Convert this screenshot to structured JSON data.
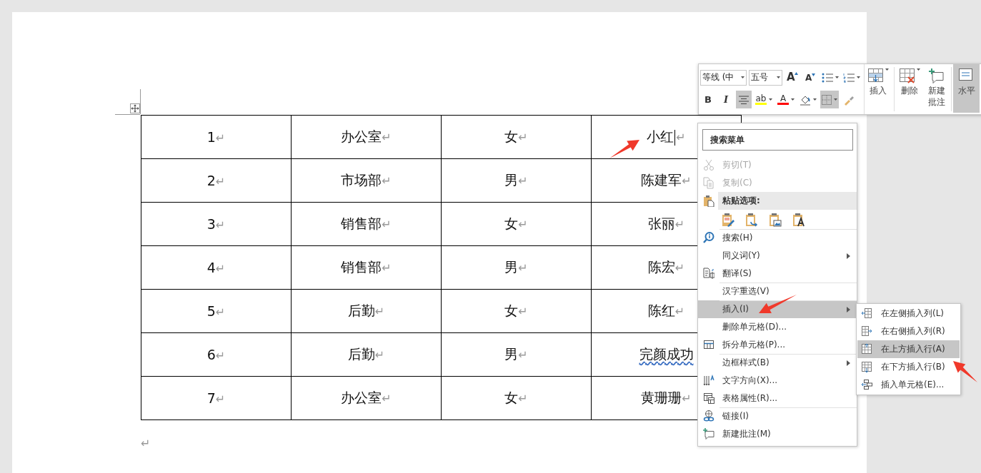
{
  "table": {
    "rows": [
      [
        {
          "text": "1",
          "end_mark": "↵"
        },
        {
          "text": "办公室",
          "end_mark": "↵"
        },
        {
          "text": "女",
          "end_mark": "↵"
        },
        {
          "text": "小红",
          "end_mark": "↵",
          "cursor": true
        }
      ],
      [
        {
          "text": "2",
          "end_mark": "↵"
        },
        {
          "text": "市场部",
          "end_mark": "↵"
        },
        {
          "text": "男",
          "end_mark": "↵"
        },
        {
          "text": "陈建军",
          "end_mark": "↵"
        }
      ],
      [
        {
          "text": "3",
          "end_mark": "↵"
        },
        {
          "text": "销售部",
          "end_mark": "↵"
        },
        {
          "text": "女",
          "end_mark": "↵"
        },
        {
          "text": "张丽",
          "end_mark": "↵"
        }
      ],
      [
        {
          "text": "4",
          "end_mark": "↵"
        },
        {
          "text": "销售部",
          "end_mark": "↵"
        },
        {
          "text": "男",
          "end_mark": "↵"
        },
        {
          "text": "陈宏",
          "end_mark": "↵"
        }
      ],
      [
        {
          "text": "5",
          "end_mark": "↵"
        },
        {
          "text": "后勤",
          "end_mark": "↵"
        },
        {
          "text": "女",
          "end_mark": "↵"
        },
        {
          "text": "陈红",
          "end_mark": "↵"
        }
      ],
      [
        {
          "text": "6",
          "end_mark": "↵"
        },
        {
          "text": "后勤",
          "end_mark": "↵"
        },
        {
          "text": "男",
          "end_mark": "↵"
        },
        {
          "text": "完颜成功",
          "spelling_error": true
        }
      ],
      [
        {
          "text": "7",
          "end_mark": "↵"
        },
        {
          "text": "办公室",
          "end_mark": "↵"
        },
        {
          "text": "女",
          "end_mark": "↵"
        },
        {
          "text": "黄珊珊",
          "end_mark": "↵"
        }
      ]
    ],
    "after_mark": "↵"
  },
  "toolbar": {
    "font_name": "等线 (中",
    "font_size": "五号",
    "row1_buttons": [
      {
        "kind": "grow",
        "glyph": "A"
      },
      {
        "kind": "shrink",
        "glyph": "A"
      },
      {
        "kind": "bullets"
      },
      {
        "kind": "numbering"
      }
    ],
    "row2_buttons": [
      {
        "kind": "bold",
        "glyph": "B",
        "selected": false
      },
      {
        "kind": "italic",
        "glyph": "I",
        "selected": false
      },
      {
        "kind": "align-center",
        "selected": true
      },
      {
        "kind": "highlight",
        "glyph": "ab",
        "color": "#ffff00",
        "selected": false
      },
      {
        "kind": "font-color",
        "glyph": "A",
        "color": "#ff0000",
        "selected": false
      },
      {
        "kind": "shading",
        "selected": false
      },
      {
        "kind": "borders",
        "selected": true
      },
      {
        "kind": "format-painter",
        "selected": false
      }
    ],
    "big_buttons": [
      {
        "kind": "insert-table",
        "label": "插入",
        "selected": false
      },
      {
        "kind": "delete-table",
        "label": "删除",
        "selected": false
      },
      {
        "kind": "comment",
        "label": "新建批注",
        "selected": false
      },
      {
        "kind": "align",
        "label": "水平",
        "selected": true
      }
    ]
  },
  "context_menu": {
    "search": {
      "placeholder": "搜索菜单"
    },
    "items": [
      {
        "kind": "item",
        "label": "剪切(T)",
        "disabled": true,
        "selected": false,
        "submenu": false,
        "separator_before": false
      },
      {
        "kind": "item",
        "label": "复制(C)",
        "disabled": true,
        "selected": false,
        "submenu": false,
        "separator_before": false
      },
      {
        "kind": "header",
        "label": "粘贴选项:"
      },
      {
        "kind": "paste-options"
      },
      {
        "kind": "item",
        "label": "搜索(H)",
        "disabled": false,
        "selected": false,
        "submenu": false,
        "separator_before": true
      },
      {
        "kind": "item",
        "label": "同义词(Y)",
        "disabled": false,
        "selected": false,
        "submenu": true,
        "separator_before": false
      },
      {
        "kind": "item",
        "label": "翻译(S)",
        "disabled": false,
        "selected": false,
        "submenu": false,
        "separator_before": false
      },
      {
        "kind": "item",
        "label": "汉字重选(V)",
        "disabled": false,
        "selected": false,
        "submenu": false,
        "separator_before": true
      },
      {
        "kind": "item",
        "label": "插入(I)",
        "disabled": false,
        "selected": true,
        "submenu": true,
        "separator_before": true
      },
      {
        "kind": "item",
        "label": "删除单元格(D)...",
        "disabled": false,
        "selected": false,
        "submenu": false,
        "separator_before": false
      },
      {
        "kind": "item",
        "label": "拆分单元格(P)...",
        "disabled": false,
        "selected": false,
        "submenu": false,
        "separator_before": false
      },
      {
        "kind": "item",
        "label": "边框样式(B)",
        "disabled": false,
        "selected": false,
        "submenu": true,
        "separator_before": true
      },
      {
        "kind": "item",
        "label": "文字方向(X)...",
        "disabled": false,
        "selected": false,
        "submenu": false,
        "separator_before": false
      },
      {
        "kind": "item",
        "label": "表格属性(R)...",
        "disabled": false,
        "selected": false,
        "submenu": false,
        "separator_before": false
      },
      {
        "kind": "item",
        "label": "链接(I)",
        "disabled": false,
        "selected": false,
        "submenu": false,
        "separator_before": true
      },
      {
        "kind": "item",
        "label": "新建批注(M)",
        "disabled": false,
        "selected": false,
        "submenu": false,
        "separator_before": false
      }
    ]
  },
  "submenu": {
    "items": [
      {
        "label": "在左侧插入列(L)",
        "selected": false
      },
      {
        "label": "在右侧插入列(R)",
        "selected": false
      },
      {
        "label": "在上方插入行(A)",
        "selected": true
      },
      {
        "label": "在下方插入行(B)",
        "selected": false
      },
      {
        "label": "插入单元格(E)...",
        "selected": false
      }
    ]
  }
}
